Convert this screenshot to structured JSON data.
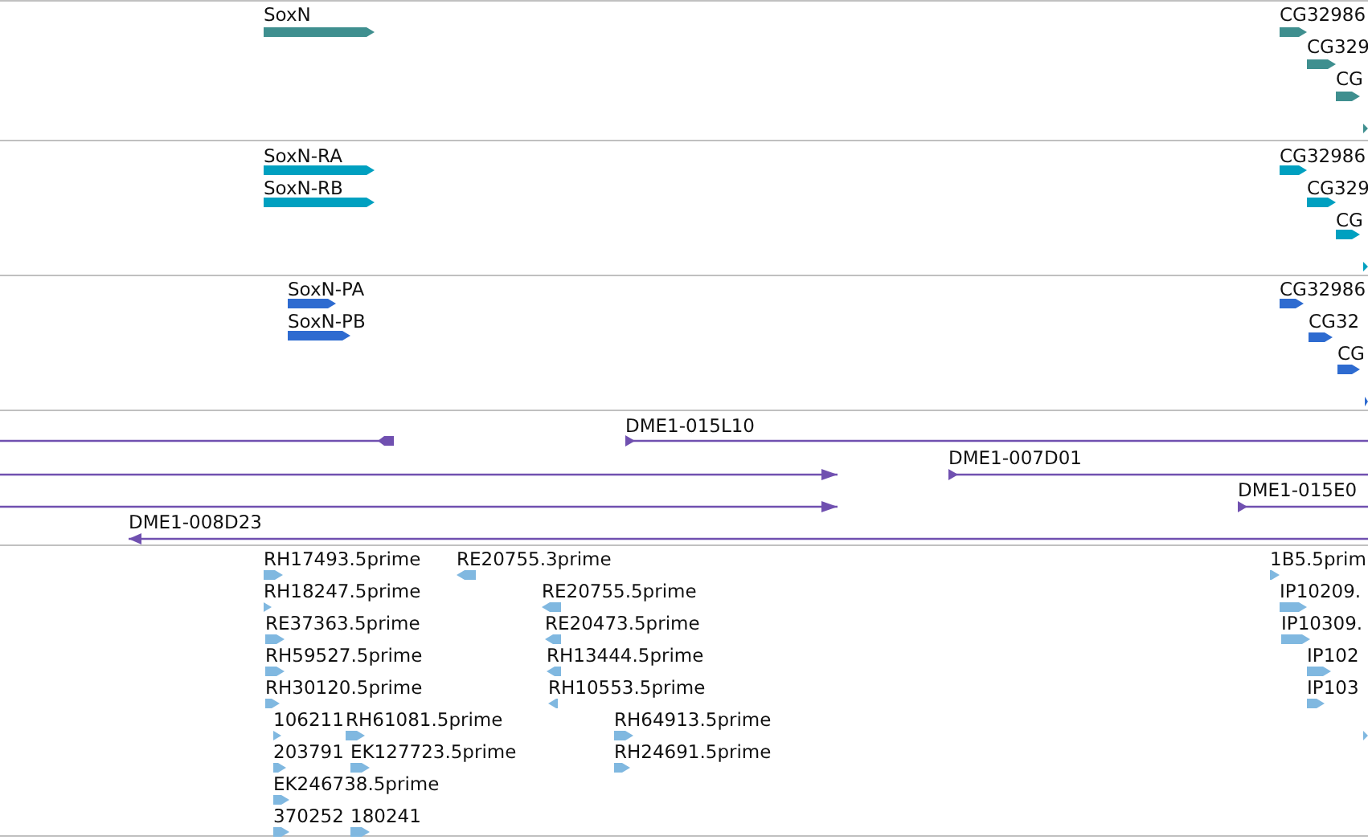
{
  "tracks": [
    {
      "kind": "gene",
      "color": "#3f8f8f",
      "features": [
        {
          "label": "SoxN",
          "reverse": false
        },
        {
          "label": "CG32986",
          "reverse": false
        },
        {
          "label": "CG329",
          "reverse": false
        },
        {
          "label": "CG",
          "reverse": false
        },
        {
          "reverse": false
        }
      ]
    },
    {
      "kind": "transcript",
      "color": "#00a0c0",
      "features": [
        {
          "label": "SoxN-RA",
          "reverse": false
        },
        {
          "label": "SoxN-RB",
          "reverse": false
        },
        {
          "label": "CG32986",
          "reverse": false
        },
        {
          "label": "CG329",
          "reverse": false
        },
        {
          "label": "CG",
          "reverse": false
        },
        {
          "reverse": false
        }
      ]
    },
    {
      "kind": "protein",
      "color": "#2e6bd0",
      "features": [
        {
          "label": "SoxN-PA",
          "reverse": false
        },
        {
          "label": "SoxN-PB",
          "reverse": false
        },
        {
          "label": "CG32986",
          "reverse": false
        },
        {
          "label": "CG32",
          "reverse": false
        },
        {
          "label": "CG",
          "reverse": false
        },
        {
          "reverse": false
        }
      ]
    },
    {
      "kind": "clone",
      "color": "#7050b0",
      "features": [
        {
          "reverse": true
        },
        {
          "label": "DME1-015L10",
          "reverse": false
        },
        {
          "reverse": false
        },
        {
          "label": "DME1-007D01",
          "reverse": false
        },
        {
          "reverse": false
        },
        {
          "label": "DME1-015E0",
          "reverse": false
        },
        {
          "label": "DME1-008D23",
          "reverse": true
        }
      ]
    },
    {
      "kind": "est",
      "color": "#80b8e0",
      "features": [
        {
          "label": "RH17493.5prime",
          "reverse": false
        },
        {
          "label": "RE20755.3prime",
          "reverse": true
        },
        {
          "label": "1B5.5prim",
          "reverse": false
        },
        {
          "label": "RH18247.5prime",
          "reverse": false
        },
        {
          "label": "RE20755.5prime",
          "reverse": true
        },
        {
          "label": "IP10209.",
          "reverse": false
        },
        {
          "label": "RE37363.5prime",
          "reverse": false
        },
        {
          "label": "RE20473.5prime",
          "reverse": true
        },
        {
          "label": "IP10309.",
          "reverse": false
        },
        {
          "label": "RH59527.5prime",
          "reverse": false
        },
        {
          "label": "RH13444.5prime",
          "reverse": true
        },
        {
          "label": "IP102",
          "reverse": false
        },
        {
          "label": "RH30120.5prime",
          "reverse": false
        },
        {
          "label": "RH10553.5prime",
          "reverse": true
        },
        {
          "label": "IP103",
          "reverse": false
        },
        {
          "label": "106211",
          "reverse": false
        },
        {
          "label": "RH61081.5prime",
          "reverse": false
        },
        {
          "label": "RH64913.5prime",
          "reverse": false
        },
        {
          "reverse": false
        },
        {
          "label": "203791",
          "reverse": false
        },
        {
          "label": "EK127723.5prime",
          "reverse": false
        },
        {
          "label": "RH24691.5prime",
          "reverse": false
        },
        {
          "label": "EK246738.5prime",
          "reverse": false
        },
        {
          "label": "370252",
          "reverse": false
        },
        {
          "label": "180241",
          "reverse": false
        }
      ]
    }
  ]
}
